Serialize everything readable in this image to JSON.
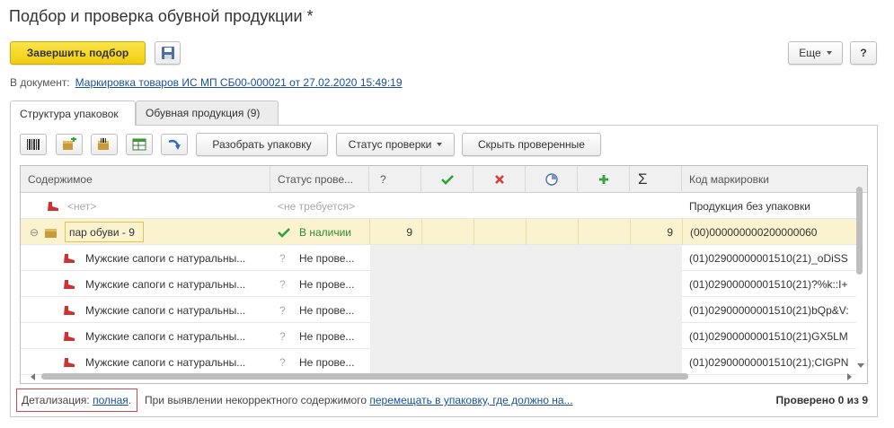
{
  "window": {
    "title": "Подбор и проверка обувной продукции *"
  },
  "toolbar": {
    "finish_label": "Завершить подбор",
    "more_label": "Еще",
    "help_label": "?"
  },
  "doc": {
    "prefix": "В документ:",
    "link": "Маркировка товаров ИС МП СБ00-000021 от 27.02.2020 15:49:19"
  },
  "tabs": [
    {
      "label": "Структура упаковок",
      "active": true
    },
    {
      "label": "Обувная продукция (9)",
      "active": false
    }
  ],
  "grid_toolbar": {
    "unpack_label": "Разобрать упаковку",
    "status_label": "Статус проверки",
    "hide_label": "Скрыть проверенные"
  },
  "columns": {
    "content": "Содержимое",
    "status": "Статус прове...",
    "question": "?",
    "code": "Код маркировки"
  },
  "rows": [
    {
      "content": "<нет>",
      "status": "<не требуется>",
      "q": "",
      "sum": "",
      "code": "Продукция без упаковки"
    },
    {
      "content": "пар обуви - 9",
      "status": "В наличии",
      "q": "9",
      "sum": "9",
      "code": "(00)000000000200000060"
    },
    {
      "content": "Мужские сапоги с натуральны...",
      "status_mark": "?",
      "status": "Не прове...",
      "code": "(01)02900000001510(21)_oDiSS"
    },
    {
      "content": "Мужские сапоги с натуральны...",
      "status_mark": "?",
      "status": "Не прове...",
      "code": "(01)02900000001510(21)?%k::I+"
    },
    {
      "content": "Мужские сапоги с натуральны...",
      "status_mark": "?",
      "status": "Не прове...",
      "code": "(01)02900000001510(21)bQp&V:"
    },
    {
      "content": "Мужские сапоги с натуральны...",
      "status_mark": "?",
      "status": "Не прове...",
      "code": "(01)02900000001510(21)GX5LM"
    },
    {
      "content": "Мужские сапоги с натуральны...",
      "status_mark": "?",
      "status": "Не прове...",
      "code": "(01)02900000001510(21);CIGPN"
    }
  ],
  "footer": {
    "detail_prefix": "Детализация:",
    "detail_link": "полная",
    "detail_suffix": ".",
    "mid_text": "При выявлении некорректного содержимого",
    "mid_link": "перемещать в упаковку, где должно на...",
    "checked": "Проверено 0 из 9"
  },
  "colors": {
    "accent": "#f5d31f",
    "link": "#1a4f9c",
    "ok": "#2e8b2e",
    "error": "#d83a3a"
  }
}
